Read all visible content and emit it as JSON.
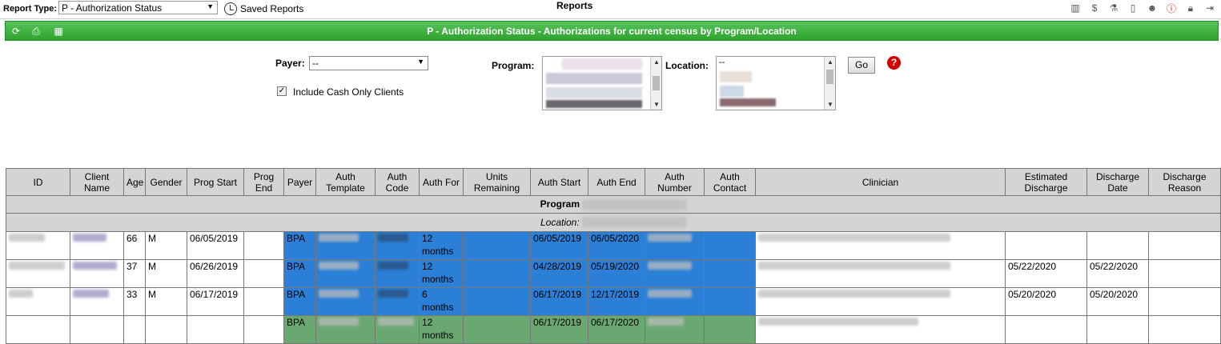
{
  "topbar": {
    "report_type_label": "Report Type:",
    "report_type_value": "P - Authorization Status",
    "saved_reports": "Saved Reports",
    "page_title": "Reports"
  },
  "greenbar": {
    "title": "P - Authorization Status - Authorizations for current census by Program/Location"
  },
  "filters": {
    "payer_label": "Payer:",
    "payer_value": "--",
    "include_cash_label": "Include Cash Only Clients",
    "include_cash_checked": true,
    "program_label": "Program:",
    "location_label": "Location:",
    "location_first_option": "--",
    "go_label": "Go",
    "help_label": "?"
  },
  "table": {
    "headers": [
      "ID",
      "Client Name",
      "Age",
      "Gender",
      "Prog Start",
      "Prog End",
      "Payer",
      "Auth Template",
      "Auth Code",
      "Auth For",
      "Units Remaining",
      "Auth Start",
      "Auth End",
      "Auth Number",
      "Auth Contact",
      "Clinician",
      "Estimated Discharge",
      "Discharge Date",
      "Discharge Reason"
    ],
    "program_group": "Program",
    "location_group": "Location:",
    "rows": [
      {
        "age": "66",
        "gender": "M",
        "prog_start": "06/05/2019",
        "payer": "BPA",
        "auth_for": "12 months",
        "auth_start": "06/05/2019",
        "auth_end": "06/05/2020",
        "est_discharge": "",
        "discharge_date": ""
      },
      {
        "age": "37",
        "gender": "M",
        "prog_start": "06/26/2019",
        "payer": "BPA",
        "auth_for": "12 months",
        "auth_start": "04/28/2019",
        "auth_end": "05/19/2020",
        "est_discharge": "05/22/2020",
        "discharge_date": "05/22/2020"
      },
      {
        "age": "33",
        "gender": "M",
        "prog_start": "06/17/2019",
        "payer": "BPA",
        "auth_for": "6 months",
        "auth_start": "06/17/2019",
        "auth_end": "12/17/2019",
        "est_discharge": "05/20/2020",
        "discharge_date": "05/20/2020"
      },
      {
        "age": "",
        "gender": "",
        "prog_start": "",
        "payer": "BPA",
        "auth_for": "12 months",
        "auth_start": "06/17/2019",
        "auth_end": "06/17/2020",
        "est_discharge": "",
        "discharge_date": ""
      }
    ]
  },
  "colors": {
    "green_bar": "#2ea32e",
    "auth_blue": "#2b7fd6",
    "auth_green": "#6aa872",
    "header_gray": "#d4d4d4"
  }
}
